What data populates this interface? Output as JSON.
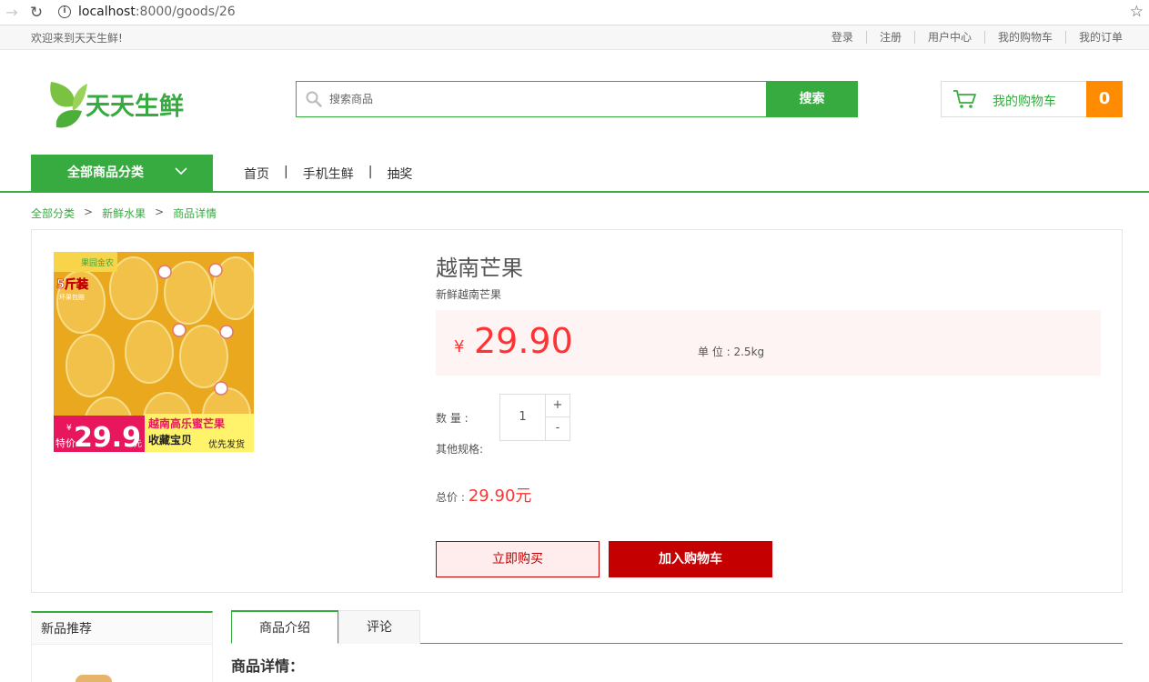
{
  "browser": {
    "url_host": "localhost",
    "url_rest": ":8000/goods/26",
    "icons": [
      "back-icon",
      "reload-icon",
      "info-icon",
      "star-icon"
    ]
  },
  "topbar": {
    "welcome": "欢迎来到天天生鲜!",
    "links": [
      "登录",
      "注册",
      "用户中心",
      "我的购物车",
      "我的订单"
    ]
  },
  "header": {
    "logo_text": "天天生鲜",
    "search_placeholder": "搜索商品",
    "search_button": "搜索",
    "cart_label": "我的购物车",
    "cart_count": "0"
  },
  "nav": {
    "all_categories": "全部商品分类",
    "links": [
      "首页",
      "手机生鲜",
      "抽奖"
    ],
    "separator": "|"
  },
  "breadcrumb": {
    "items": [
      "全部分类",
      "新鲜水果",
      "商品详情"
    ],
    "separator": ">"
  },
  "product": {
    "name": "越南芒果",
    "desc": "新鲜越南芒果",
    "currency": "¥",
    "price": "29.90",
    "unit": "单 位 : 2.5kg",
    "qty_label": "数 量 :",
    "qty": "1",
    "plus": "+",
    "minus": "-",
    "spec_label": "其他规格:",
    "total_label": "总价 :",
    "total": "29.90元",
    "buy_now": "立即购买",
    "add_cart": "加入购物车",
    "image_text": {
      "brand": "果园金农",
      "pack": "5斤装",
      "pack_sub": "坏果包赔",
      "yen": "¥",
      "sale_label": "特价",
      "price_big": "29.9",
      "price_unit": "元",
      "line1": "越南高乐蜜芒果",
      "line2": "收藏宝贝",
      "line3": "优先发货"
    }
  },
  "sidebar": {
    "new_goods_title": "新品推荐"
  },
  "tabs": [
    "商品介绍",
    "评论"
  ],
  "detail_title": "商品详情：",
  "colors": {
    "brand_green": "#37ab40",
    "price_red": "#ff3333",
    "buy_red": "#c40000",
    "cart_orange": "#ff8c00"
  }
}
